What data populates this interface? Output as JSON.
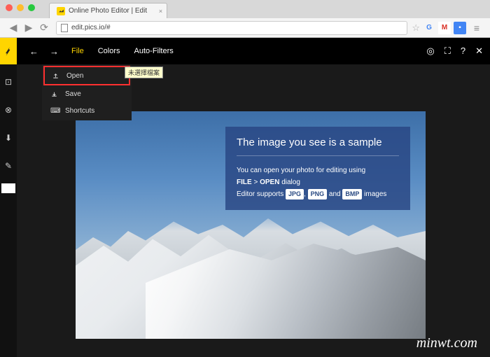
{
  "browser": {
    "tab_title": "Online Photo Editor | Edit",
    "url": "edit.pics.io/#"
  },
  "menubar": {
    "file": "File",
    "colors": "Colors",
    "autofilters": "Auto-Filters"
  },
  "dropdown": {
    "open": "Open",
    "save": "Save",
    "shortcuts": "Shortcuts",
    "tooltip": "未選擇檔案"
  },
  "infobox": {
    "title": "The image you see is a sample",
    "line1": "You can open your photo for editing using",
    "f_file": "FILE",
    "f_gt": ">",
    "f_open": "OPEN",
    "f_dialog": " dialog",
    "l2a": "Editor supports ",
    "jpg": "JPG",
    "png": "PNG",
    "bmp": "BMP",
    "l2b": " and ",
    "l2c": " images"
  },
  "watermark": "minwt.com"
}
